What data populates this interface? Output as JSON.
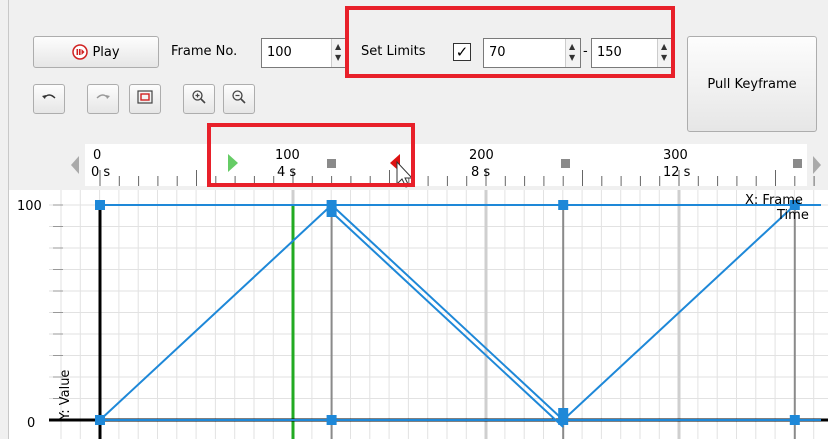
{
  "toolbar": {
    "play_label": "Play",
    "frame_no_label": "Frame No.",
    "frame_no_value": "100",
    "set_limits_label": "Set Limits",
    "set_limits_checked": "✓",
    "limit_min": "70",
    "limit_max": "150",
    "limit_dash": "-",
    "pull_keyframe_label": "Pull Keyframe"
  },
  "icons": [
    "undo-icon",
    "redo-icon",
    "fit-view-icon",
    "zoom-in-icon",
    "zoom-out-icon",
    "play-pause-icon"
  ],
  "timeline": {
    "ticks": [
      {
        "frame": "0",
        "time": "0 s"
      },
      {
        "frame": "100",
        "time": "4 s"
      },
      {
        "frame": "200",
        "time": "8 s"
      },
      {
        "frame": "300",
        "time": "12 s"
      }
    ],
    "limit_start_frame": 70,
    "limit_end_frame": 150
  },
  "graph": {
    "x_axis_label_line1": "X: Frame",
    "x_axis_label_line2": "Time",
    "y_axis_label": "Y: Value",
    "y_max_label": "100",
    "y_min_label": "0",
    "current_frame": 100,
    "keyframes": [
      0,
      120,
      240,
      360
    ],
    "colors": {
      "curve": "#1e88d8",
      "current_frame": "#22aa22",
      "limit_start": "#66cc66",
      "limit_end": "#dd1111",
      "highlight": "#e8202a"
    }
  }
}
